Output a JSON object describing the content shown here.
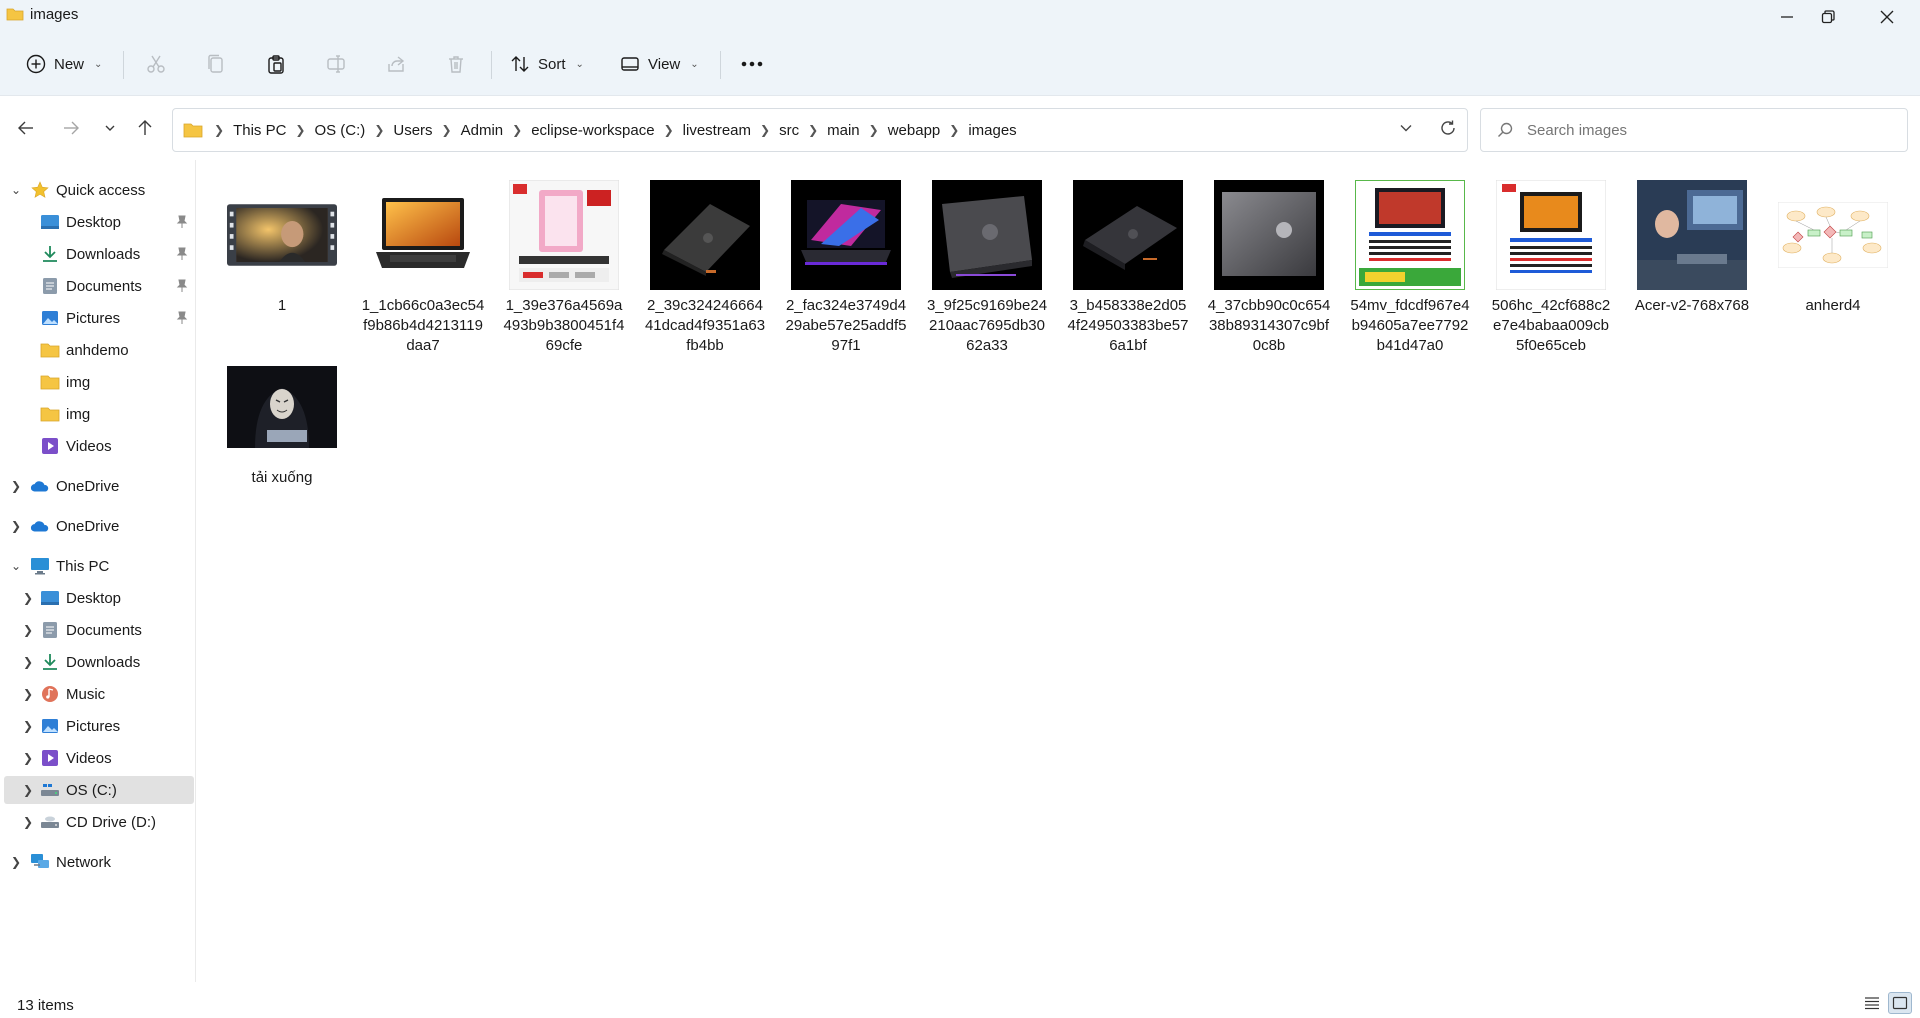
{
  "window": {
    "title": "images"
  },
  "commands": {
    "new_label": "New",
    "sort_label": "Sort",
    "view_label": "View"
  },
  "address": {
    "crumbs": [
      "This PC",
      "OS (C:)",
      "Users",
      "Admin",
      "eclipse-workspace",
      "livestream",
      "src",
      "main",
      "webapp",
      "images"
    ]
  },
  "search": {
    "placeholder": "Search images"
  },
  "sidebar": {
    "quick_access": "Quick access",
    "quick_items": [
      "Desktop",
      "Downloads",
      "Documents",
      "Pictures",
      "anhdemo",
      "img",
      "img",
      "Videos"
    ],
    "onedrive_1": "OneDrive",
    "onedrive_2": "OneDrive",
    "this_pc": "This PC",
    "pc_items": [
      "Desktop",
      "Documents",
      "Downloads",
      "Music",
      "Pictures",
      "Videos",
      "OS (C:)",
      "CD Drive (D:)"
    ],
    "network": "Network"
  },
  "files": [
    {
      "name": "1",
      "kind": "video"
    },
    {
      "name": "1_1cb66c0a3ec54f9b86b4d4213119daa7",
      "kind": "laptop-orange"
    },
    {
      "name": "1_39e376a4569a493b9b3800451f469cfe",
      "kind": "pink-pc"
    },
    {
      "name": "2_39c32424666441dcad4f9351a63fb4bb",
      "kind": "laptop-back"
    },
    {
      "name": "2_fac324e3749d429abe57e25addf597f1",
      "kind": "laptop-rgb"
    },
    {
      "name": "3_9f25c9169be24210aac7695db3062a33",
      "kind": "laptop-back"
    },
    {
      "name": "3_b458338e2d054f249503383be576a1bf",
      "kind": "laptop-back"
    },
    {
      "name": "4_37cbb90c0c65438b89314307c9bf0c8b",
      "kind": "laptop-lid"
    },
    {
      "name": "54mv_fdcdf967e4b94605a7ee7792b41d47a0",
      "kind": "promo-green"
    },
    {
      "name": "506hc_42cf688c2e7e4babaa009cb5f0e65ceb",
      "kind": "promo-red"
    },
    {
      "name": "Acer-v2-768x768",
      "kind": "photo-desk"
    },
    {
      "name": "anherd4",
      "kind": "diagram"
    },
    {
      "name": "tải xuống",
      "kind": "hacker"
    }
  ],
  "status": {
    "count": "13 items"
  }
}
